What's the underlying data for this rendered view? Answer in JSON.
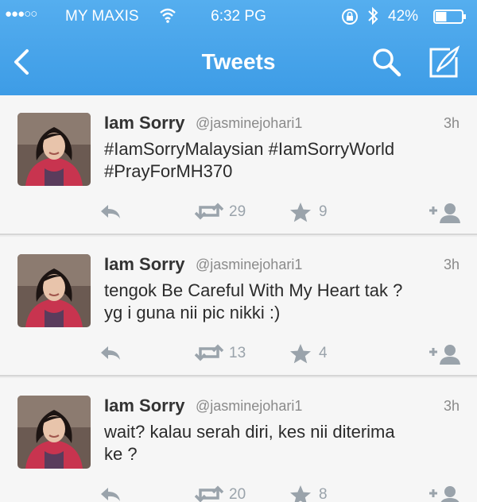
{
  "status_bar": {
    "signal": "●●●○○",
    "carrier": "MY MAXIS",
    "time": "6:32 PG",
    "battery_pct": "42%",
    "battery_level": 0.42,
    "icons": [
      "wifi-icon",
      "rotation-lock-icon",
      "bluetooth-icon",
      "battery-icon"
    ]
  },
  "navbar": {
    "title": "Tweets",
    "icons": [
      "back-chevron-icon",
      "search-icon",
      "compose-icon"
    ]
  },
  "colors": {
    "nav_blue": "#3d9ce6",
    "feed_bg": "#f6f6f6",
    "action_gray": "#9aa3ab",
    "text": "#2b2b2b"
  },
  "tweets": [
    {
      "name": "Iam Sorry",
      "handle": "@jasminejohari1",
      "time": "3h",
      "lines": [
        "#IamSorryMalaysian #IamSorryWorld",
        "#PrayForMH370"
      ],
      "retweets": "29",
      "favorites": "9"
    },
    {
      "name": "Iam Sorry",
      "handle": "@jasminejohari1",
      "time": "3h",
      "lines": [
        "tengok Be Careful With My Heart tak ?",
        "yg i guna nii pic nikki :)"
      ],
      "retweets": "13",
      "favorites": "4"
    },
    {
      "name": "Iam Sorry",
      "handle": "@jasminejohari1",
      "time": "3h",
      "lines": [
        "wait? kalau serah diri, kes nii diterima",
        "ke ?"
      ],
      "retweets": "20",
      "favorites": "8"
    }
  ]
}
